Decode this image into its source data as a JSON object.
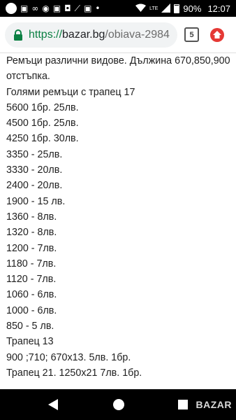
{
  "status_bar": {
    "battery": "90%",
    "time": "12:07",
    "network": "LTE",
    "icons": [
      "circle-icon",
      "image-icon",
      "voicemail-icon",
      "browser-icon",
      "image-icon",
      "shopping-bag-icon",
      "broom-icon",
      "image-icon",
      "more-dot-icon",
      "wifi-icon",
      "signal-icon",
      "battery-icon"
    ]
  },
  "browser": {
    "url_scheme": "https://",
    "url_host": "bazar.bg",
    "url_path": "/obiava-2984",
    "tab_count": "5"
  },
  "content": {
    "lines": [
      "Ремъци различни видове. Дължина 670,850,900",
      "отстъпка.",
      "Голями ремъци с трапец 17",
      "5600 1бр. 25лв.",
      "4500 1бр. 25лв.",
      "4250 1бр. 30лв.",
      "3350 - 25лв.",
      "3330 - 20лв.",
      "2400 - 20лв.",
      "1900 - 15 лв.",
      "1360 - 8лв.",
      "1320 - 8лв.",
      "1200 - 7лв.",
      "1180 - 7лв.",
      "1120 - 7лв.",
      "1060 - 6лв.",
      "1000 - 6лв.",
      "850 - 5 лв.",
      "Трапец 13",
      "900 ;710; 670х13. 5лв. 1бр.",
      "Трапец 21. 1250х21 7лв. 1бр."
    ]
  },
  "nav": {
    "icons": [
      "back-icon",
      "home-icon",
      "recents-icon"
    ]
  },
  "watermark": {
    "text": "BAZAR"
  },
  "colors": {
    "status_bar": "#000000",
    "https_green": "#0b8043",
    "home_red": "#e53935",
    "url_field": "#f1f3f4"
  }
}
